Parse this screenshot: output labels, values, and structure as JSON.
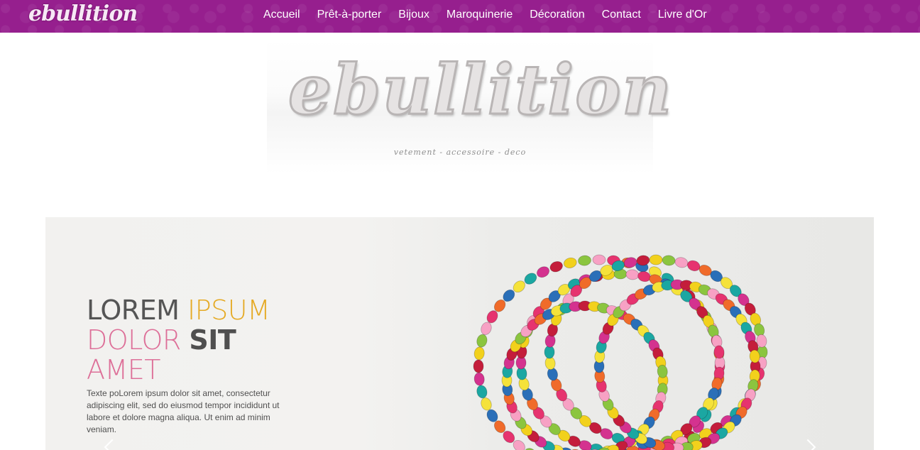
{
  "header": {
    "brand": "ebullition",
    "nav": [
      "Accueil",
      "Prêt-à-porter",
      "Bijoux",
      "Maroquinerie",
      "Décoration",
      "Contact",
      "Livre d'Or"
    ]
  },
  "logo": {
    "word": "ebullition",
    "tagline": "vetement - accessoire - deco"
  },
  "slide": {
    "title_line1_a": "LOREM ",
    "title_line1_b": "IPSUM",
    "title_line2_a": "DOLOR ",
    "title_line2_b": "SIT",
    "title_line3": "AMET",
    "text": "Texte poLorem ipsum dolor sit amet, consectetur adipiscing elit, sed do eiusmod tempor incididunt ut labore et dolore magna aliqua. Ut enim ad minim veniam."
  },
  "colors": {
    "nav_bg": "#961f8e",
    "gold": "#e5aa24",
    "pink": "#dd6f98"
  }
}
